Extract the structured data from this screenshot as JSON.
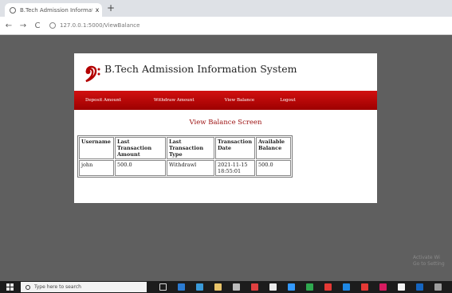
{
  "browser": {
    "tab_title": "B.Tech Admission Information S",
    "tab_close": "x",
    "new_tab": "+",
    "back": "←",
    "forward": "→",
    "reload": "C",
    "url": "127.0.0.1:5000/ViewBalance"
  },
  "page": {
    "site_title": "B.Tech Admission Information System",
    "nav": [
      "Deposit Amount",
      "Withdraw Amount",
      "View Balance",
      "Logout"
    ],
    "screen_title": "View Balance Screen",
    "table": {
      "headers": [
        "Username",
        "Last Transaction Amount",
        "Last Transaction Type",
        "Transaction Date",
        "Available Balance"
      ],
      "rows": [
        [
          "john",
          "500.0",
          "Withdrawl",
          "2021-11-15 18:55:01",
          "500.0"
        ]
      ]
    }
  },
  "watermark": [
    "Activate Wi",
    "Go to Setting"
  ],
  "taskbar": {
    "search_placeholder": "Type here to search"
  },
  "colors": {
    "nav_red": "#c00000",
    "screen_title": "#9c1010"
  }
}
